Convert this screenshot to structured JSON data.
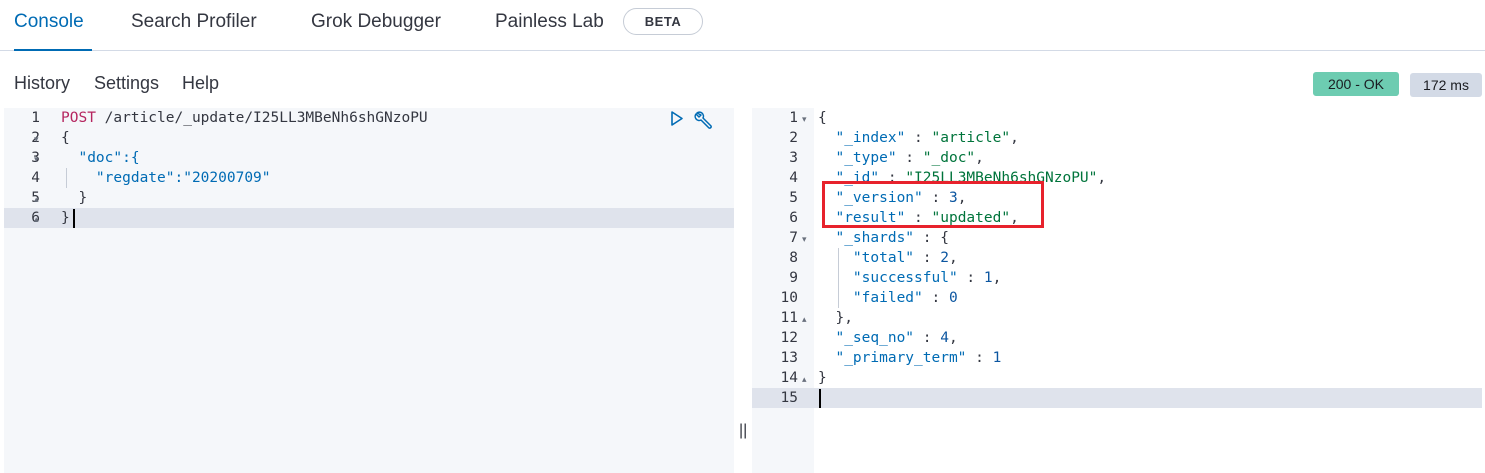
{
  "tabs": [
    {
      "label": "Console"
    },
    {
      "label": "Search Profiler"
    },
    {
      "label": "Grok Debugger"
    },
    {
      "label": "Painless Lab"
    }
  ],
  "beta_badge": "BETA",
  "menu": {
    "history": "History",
    "settings": "Settings",
    "help": "Help"
  },
  "response_status": "200 - OK",
  "response_time": "172 ms",
  "request": {
    "line_numbers": [
      "1",
      "2",
      "3",
      "4",
      "5",
      "6"
    ],
    "method": "POST",
    "url": " /article/_update/I25LL3MBeNh6shGNzoPU",
    "lines": [
      {
        "t": "{"
      },
      {
        "t": "  \"doc\":{"
      },
      {
        "t": "    \"regdate\":\"20200709\""
      },
      {
        "t": "  }"
      },
      {
        "t": "}"
      }
    ]
  },
  "response": {
    "line_numbers": [
      "1",
      "2",
      "3",
      "4",
      "5",
      "6",
      "7",
      "8",
      "9",
      "10",
      "11",
      "12",
      "13",
      "14",
      "15"
    ],
    "lines": [
      "{",
      "  \"_index\" : \"article\",",
      "  \"_type\" : \"_doc\",",
      "  \"_id\" : \"I25LL3MBeNh6shGNzoPU\",",
      "  \"_version\" : 3,",
      "  \"result\" : \"updated\",",
      "  \"_shards\" : {",
      "    \"total\" : 2,",
      "    \"successful\" : 1,",
      "    \"failed\" : 0",
      "  },",
      "  \"_seq_no\" : 4,",
      "  \"_primary_term\" : 1",
      "}",
      ""
    ]
  },
  "icons": {
    "run": "play-icon",
    "settings": "wrench-icon",
    "resize": "resize-handle-icon"
  }
}
